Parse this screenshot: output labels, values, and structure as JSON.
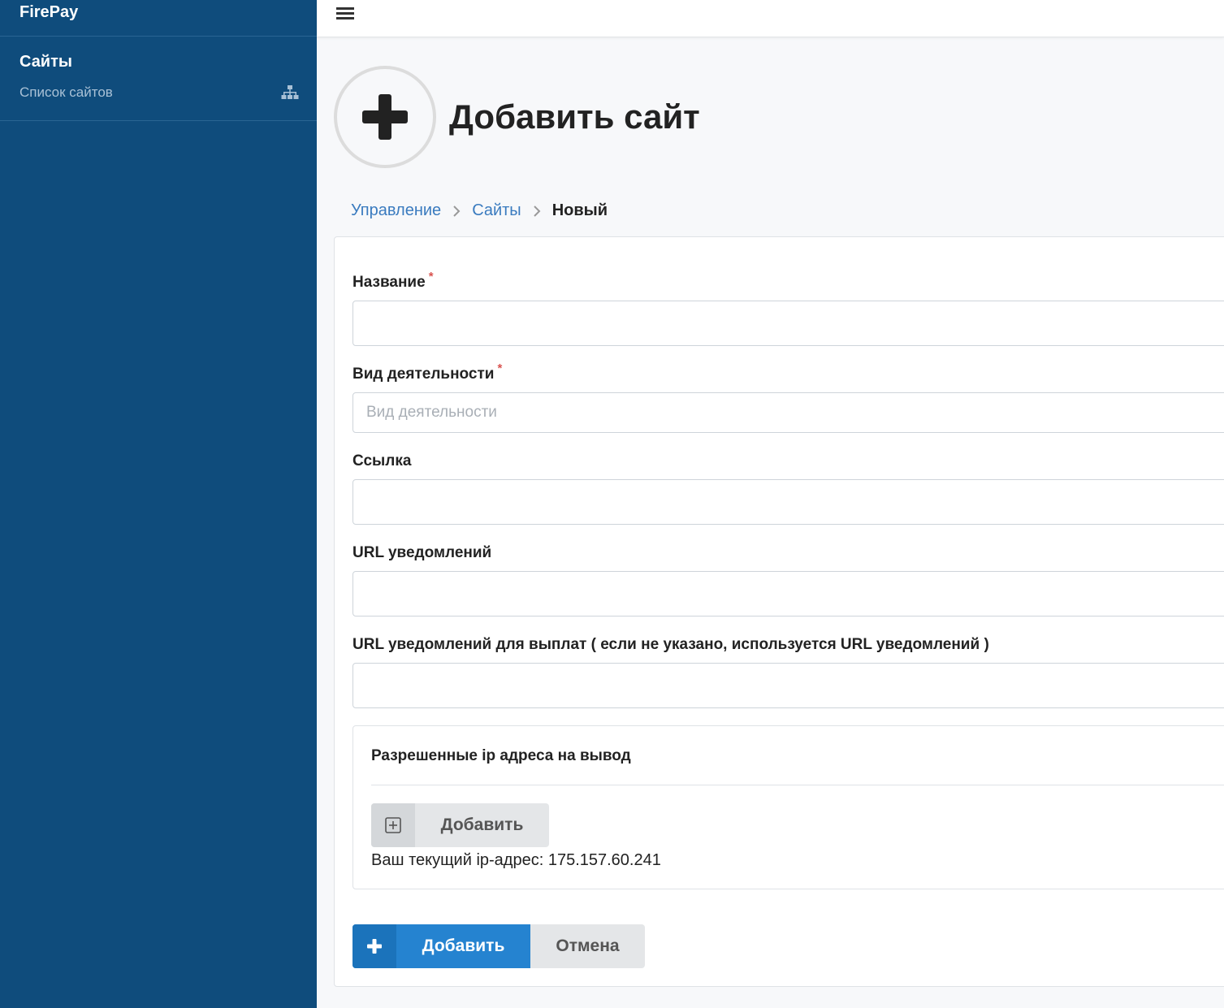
{
  "sidebar": {
    "brand": "FirePay",
    "section_title": "Сайты",
    "items": [
      {
        "label": "Список сайтов",
        "icon": "sitemap-icon"
      }
    ]
  },
  "header": {
    "menu_icon": "hamburger-icon"
  },
  "page": {
    "title": "Добавить сайт",
    "icon": "plus-icon"
  },
  "breadcrumb": [
    {
      "label": "Управление"
    },
    {
      "label": "Сайты"
    },
    {
      "label": "Новый"
    }
  ],
  "form": {
    "fields": [
      {
        "label": "Название",
        "required": "*",
        "value": "",
        "placeholder": ""
      },
      {
        "label": "Вид деятельности",
        "required": "*",
        "value": "",
        "placeholder": "Вид деятельности"
      },
      {
        "label": "Ссылка",
        "value": "",
        "placeholder": ""
      },
      {
        "label": "URL уведомлений",
        "value": "",
        "placeholder": ""
      },
      {
        "label": "URL уведомлений для выплат ( если не указано, используется URL уведомлений )",
        "value": "",
        "placeholder": ""
      }
    ],
    "ip_section": {
      "title": "Разрешенные ip адреса на вывод",
      "add_label": "Добавить",
      "current_ip_text": "Ваш текущий ip-адрес: 175.157.60.241"
    },
    "submit_label": "Добавить",
    "cancel_label": "Отмена"
  },
  "colors": {
    "sidebar_bg": "#0f4c7c",
    "primary": "#2583d0",
    "link": "#3a7bbf",
    "required": "#d9534f"
  }
}
